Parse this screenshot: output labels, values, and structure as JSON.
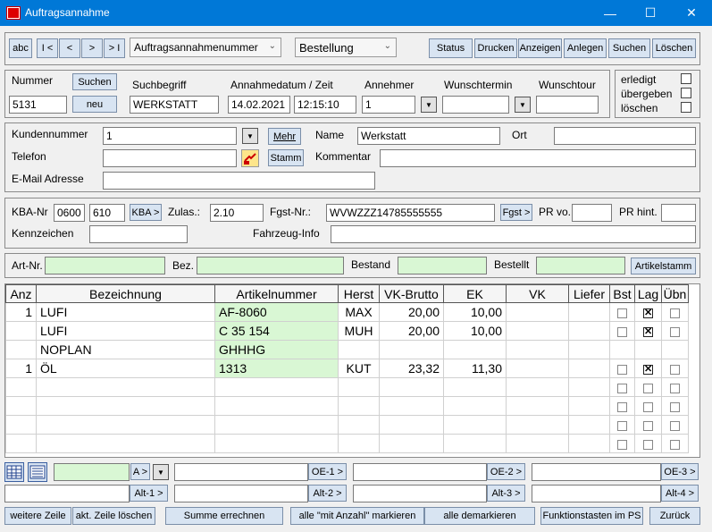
{
  "window": {
    "title": "Auftragsannahme",
    "minimize": "—",
    "maximize": "☐",
    "close": "✕"
  },
  "toolbar": {
    "nav": [
      "abc",
      "I <",
      "<",
      ">",
      "> I"
    ],
    "search_combo": "Auftragsannahmenummer",
    "type_combo": "Bestellung",
    "actions": [
      "Status",
      "Drucken",
      "Anzeigen",
      "Anlegen",
      "Suchen",
      "Löschen"
    ]
  },
  "header": {
    "nummer_label": "Nummer",
    "nummer": "5131",
    "suchen_button": "Suchen",
    "neu_button": "neu",
    "suchbegriff_label": "Suchbegriff",
    "suchbegriff": "WERKSTATT",
    "datum_label": "Annahmedatum / Zeit",
    "datum": "14.02.2021",
    "zeit": "12:15:10",
    "annehmer_label": "Annehmer",
    "annehmer": "1",
    "wunschtermin_label": "Wunschtermin",
    "wunschtermin": "",
    "wunschtour_label": "Wunschtour",
    "wunschtour": "",
    "erledigt_label": "erledigt",
    "uebergeben_label": "übergeben",
    "loeschen_label": "löschen"
  },
  "customer": {
    "kundennummer_label": "Kundennummer",
    "kundennummer": "1",
    "mehr_button": "Mehr",
    "name_label": "Name",
    "name": "Werkstatt",
    "ort_label": "Ort",
    "ort": "",
    "telefon_label": "Telefon",
    "telefon": "",
    "stamm_button": "Stamm",
    "kommentar_label": "Kommentar",
    "kommentar": "",
    "email_label": "E-Mail Adresse",
    "email": ""
  },
  "vehicle": {
    "kba_label": "KBA-Nr",
    "kba1": "0600",
    "kba2": "610",
    "kba_button": "KBA >",
    "zulas_label": "Zulas.:",
    "zulas": "2.10",
    "fgst_label": "Fgst-Nr.:",
    "fgst": "WVWZZZ14785555555",
    "fgst_button": "Fgst >",
    "prvo_label": "PR vo.",
    "prhint_label": "PR hint.",
    "kennzeichen_label": "Kennzeichen",
    "kennzeichen": "",
    "fahrzeuginfo_label": "Fahrzeug-Info",
    "fahrzeuginfo": ""
  },
  "article_search": {
    "artnr_label": "Art-Nr.",
    "bez_label": "Bez.",
    "bestand_label": "Bestand",
    "bestellt_label": "Bestellt",
    "artikelstamm_button": "Artikelstamm"
  },
  "grid": {
    "columns": [
      "Anz",
      "Bezeichnung",
      "Artikelnummer",
      "Herst",
      "VK-Brutto",
      "EK",
      "VK",
      "Liefer",
      "Bst",
      "Lag",
      "Übn"
    ],
    "rows": [
      {
        "anz": "1",
        "bez": "LUFI",
        "art": "AF-8060",
        "herst": "MAX",
        "vkb": "20,00",
        "ek": "10,00",
        "vk": "",
        "liefer": "",
        "bst": false,
        "lag": true,
        "uebn": false
      },
      {
        "anz": "",
        "bez": "LUFI",
        "art": "C 35 154",
        "herst": "MUH",
        "vkb": "20,00",
        "ek": "10,00",
        "vk": "",
        "liefer": "",
        "bst": false,
        "lag": true,
        "uebn": false
      },
      {
        "anz": "",
        "bez": "NOPLAN",
        "art": "GHHHG",
        "herst": "",
        "vkb": "",
        "ek": "",
        "vk": "",
        "liefer": "",
        "bst": null,
        "lag": null,
        "uebn": null
      },
      {
        "anz": "1",
        "bez": "ÖL",
        "art": "1313",
        "herst": "KUT",
        "vkb": "23,32",
        "ek": "11,30",
        "vk": "",
        "liefer": "",
        "bst": false,
        "lag": true,
        "uebn": false
      },
      {
        "anz": "",
        "bez": "",
        "art": "",
        "herst": "",
        "vkb": "",
        "ek": "",
        "vk": "",
        "liefer": "",
        "bst": false,
        "lag": false,
        "uebn": false
      },
      {
        "anz": "",
        "bez": "",
        "art": "",
        "herst": "",
        "vkb": "",
        "ek": "",
        "vk": "",
        "liefer": "",
        "bst": false,
        "lag": false,
        "uebn": false
      },
      {
        "anz": "",
        "bez": "",
        "art": "",
        "herst": "",
        "vkb": "",
        "ek": "",
        "vk": "",
        "liefer": "",
        "bst": false,
        "lag": false,
        "uebn": false
      },
      {
        "anz": "",
        "bez": "",
        "art": "",
        "herst": "",
        "vkb": "",
        "ek": "",
        "vk": "",
        "liefer": "",
        "bst": false,
        "lag": false,
        "uebn": false
      }
    ]
  },
  "bottom": {
    "a_button": "A >",
    "oe1": "OE-1 >",
    "oe2": "OE-2 >",
    "oe3": "OE-3 >",
    "alt1": "Alt-1 >",
    "alt2": "Alt-2 >",
    "alt3": "Alt-3 >",
    "alt4": "Alt-4 >",
    "actions": [
      "weitere Zeile",
      "akt. Zeile löschen",
      "Summe errechnen",
      "alle \"mit Anzahl\" markieren",
      "alle demarkieren",
      "Funktionstasten im PS",
      "Zurück"
    ]
  },
  "colors": {
    "titlebar": "#0078d7",
    "field_green": "#d9f7d4",
    "button_blue": "#d8e4f2"
  }
}
